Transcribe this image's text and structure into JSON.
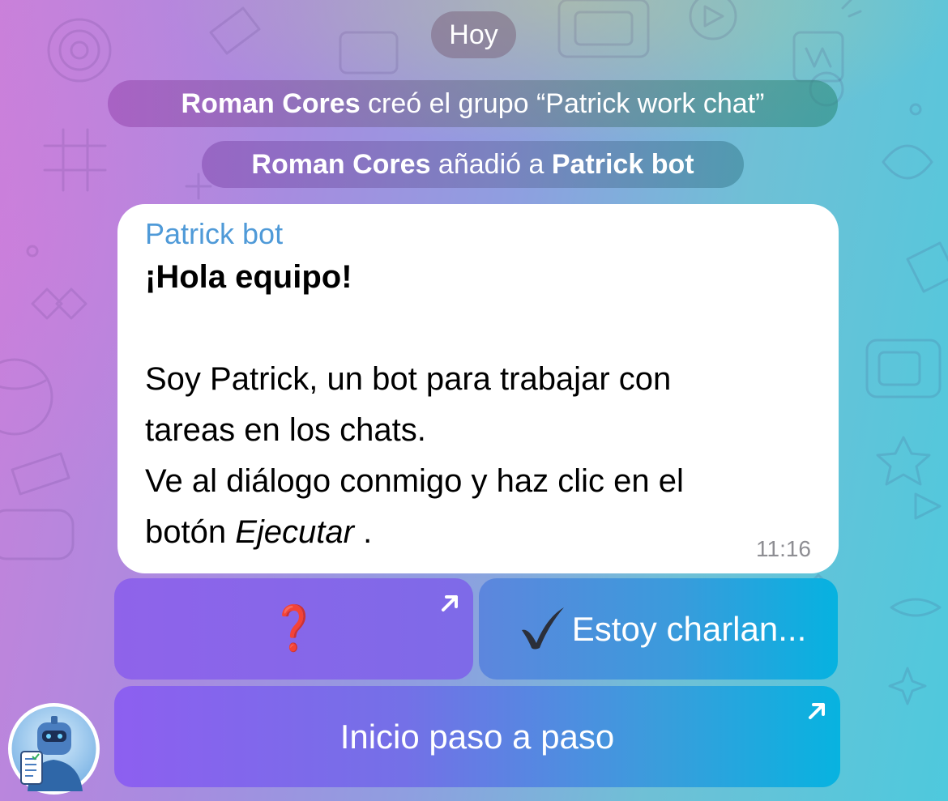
{
  "date_label": "Hoy",
  "service_messages": {
    "created": {
      "actor": "Roman Cores",
      "text": " creó el grupo “Patrick work chat”"
    },
    "added": {
      "actor": "Roman Cores",
      "text": " añadió a ",
      "target": "Patrick bot"
    }
  },
  "message": {
    "sender": "Patrick bot",
    "greeting": "¡Hola equipo!",
    "line1": "Soy Patrick, un bot para trabajar con",
    "line2": "tareas en los chats.",
    "line3": "Ve al diálogo conmigo y haz clic en el",
    "line4_start": "botón  ",
    "line4_em": "Ejecutar",
    "line4_end": " .",
    "time": "11:16"
  },
  "keyboard": {
    "help_label": "❓",
    "chat_label": "Estoy charlan...",
    "start_label": "Inicio paso a paso"
  },
  "icons": {
    "external": "arrow-up-right-icon",
    "check": "check-mark-icon",
    "avatar": "robot-avatar"
  },
  "colors": {
    "sender_name": "#4f9ad8",
    "question_mark": "#d61f1f"
  }
}
